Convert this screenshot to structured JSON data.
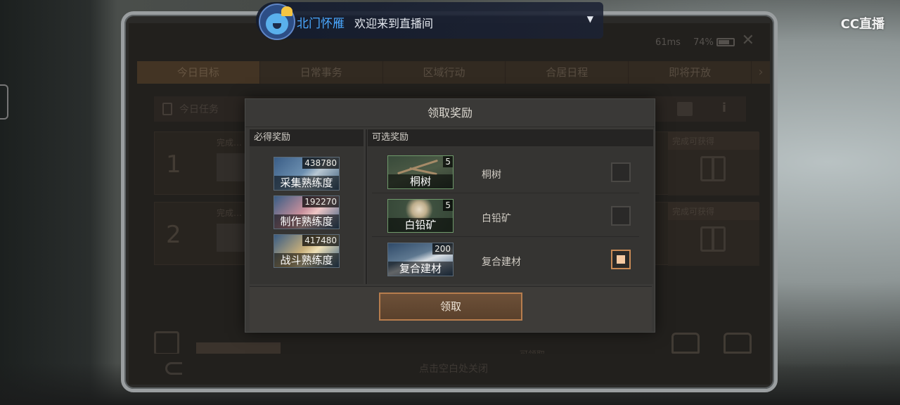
{
  "status": {
    "ping": "61ms",
    "battery": "74%"
  },
  "tabs": [
    "今日目标",
    "日常事务",
    "区域行动",
    "合居日程",
    "即将开放"
  ],
  "today_task_label": "今日任务",
  "tasks": [
    {
      "num": "1",
      "title": "完成…",
      "side_label": "完成可获得"
    },
    {
      "num": "2",
      "title": "完成…",
      "side_label": "完成可获得"
    }
  ],
  "bottom_hint": "点击空白处关闭",
  "bottom_small": "可领取",
  "dialog": {
    "title": "领取奖励",
    "left_header": "必得奖励",
    "right_header": "可选奖励",
    "guaranteed": [
      {
        "name": "采集熟练度",
        "qty": "438780",
        "art": "blue"
      },
      {
        "name": "制作熟练度",
        "qty": "192270",
        "art": "pink"
      },
      {
        "name": "战斗熟练度",
        "qty": "417480",
        "art": "gold"
      }
    ],
    "optional": [
      {
        "name": "桐树",
        "qty": "5",
        "label": "桐树",
        "checked": false
      },
      {
        "name": "白铅矿",
        "qty": "5",
        "label": "白铅矿",
        "checked": false
      },
      {
        "name": "复合建材",
        "qty": "200",
        "label": "复合建材",
        "checked": true
      }
    ],
    "confirm": "领取"
  },
  "stream_notice": {
    "name": "北门怀雁",
    "message": "欢迎来到直播间"
  },
  "platform_logo": "CC直播"
}
